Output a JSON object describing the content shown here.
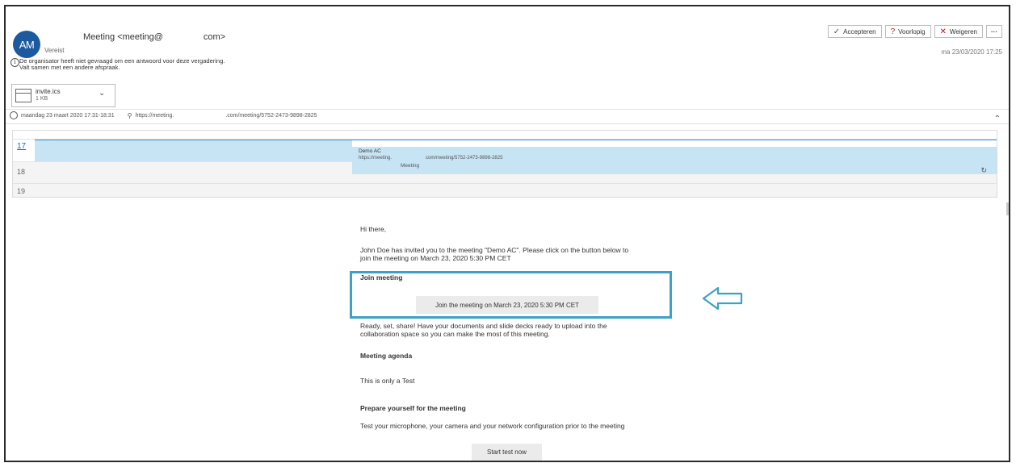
{
  "header": {
    "avatar_initials": "AM",
    "sender_prefix": "Meeting <meeting@",
    "sender_suffix": "com>",
    "required_label": "Vereist",
    "info_line1": "De organisator heeft niet gevraagd om een antwoord voor deze vergadering.",
    "info_line2": "Valt samen met een andere afspraak.",
    "date": "ma 23/03/2020 17:25"
  },
  "attachment": {
    "name": "invite.ics",
    "size": "1 KB"
  },
  "actions": {
    "accept": "Accepteren",
    "tentative": "Voorlopig",
    "decline": "Weigeren",
    "more": "···"
  },
  "details": {
    "time": "maandag 23 maart 2020 17:31-18:31",
    "location_prefix": "https://meeting.",
    "location_suffix": ".com/meeting/5752-2473-9898-2825"
  },
  "calendar": {
    "hours": [
      "17",
      "18",
      "19"
    ],
    "event_title": "Demo AC",
    "event_url_prefix": "https://meeting.",
    "event_url_suffix": "com/meeting/5752-2473-9898-2825",
    "event_sub": "Meeting"
  },
  "body": {
    "greeting": "Hi there,",
    "invite_line1": "John Doe has invited you to the meeting \"Demo AC\". Please click on the button below to",
    "invite_line2": "join the meeting on March 23, 2020 5:30 PM CET",
    "join_heading": "Join meeting",
    "join_button": "Join the meeting on March 23, 2020 5:30 PM CET",
    "ready_line1": "Ready, set, share! Have your documents and slide decks ready to upload into the",
    "ready_line2": "collaboration space so you can make the most of this meeting.",
    "agenda_heading": "Meeting agenda",
    "agenda_text": "This is only a Test",
    "prepare_heading": "Prepare yourself for the meeting",
    "prepare_text": "Test your microphone, your camera and your network configuration prior to the meeting",
    "start_button": "Start test now"
  },
  "colors": {
    "avatar": "#1b5a9e",
    "event_fill": "#c7e4f4",
    "highlight": "#3aa3c5"
  }
}
